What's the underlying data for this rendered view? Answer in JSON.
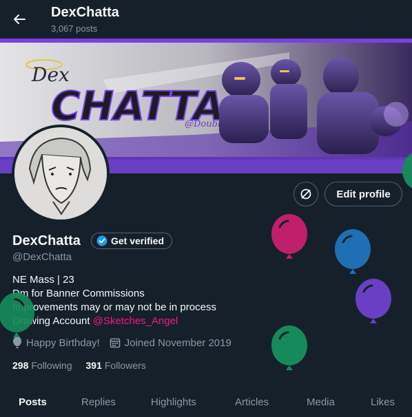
{
  "header": {
    "title": "DexChatta",
    "posts_count": "3,067 posts"
  },
  "banner": {
    "logo_script": "Dex",
    "logo_main": "CHATTA",
    "logo_tag": "@Doublers"
  },
  "profile": {
    "display_name": "DexChatta",
    "handle": "@DexChatta",
    "get_verified_label": "Get verified",
    "edit_profile_label": "Edit profile",
    "bio_lines": [
      "NE Mass | 23",
      "Dm for Banner Commissions",
      "Improvements may or may not be in process",
      "Drawing Account "
    ],
    "bio_mention": "@Sketches_Angel",
    "birthday": "Happy Birthday!",
    "joined": "Joined November 2019",
    "following_count": "298",
    "following_label": "Following",
    "followers_count": "391",
    "followers_label": "Followers"
  },
  "tabs": [
    {
      "label": "Posts",
      "active": true
    },
    {
      "label": "Replies",
      "active": false
    },
    {
      "label": "Highlights",
      "active": false
    },
    {
      "label": "Articles",
      "active": false
    },
    {
      "label": "Media",
      "active": false
    },
    {
      "label": "Likes",
      "active": false
    }
  ],
  "colors": {
    "background": "#15202b",
    "accent_verified": "#1d9bf0",
    "mention": "#f91880",
    "banner_purple": "#7b3fe4",
    "balloon_magenta": "#c0206b",
    "balloon_blue": "#1f6fb5",
    "balloon_purple": "#6a3fc4",
    "balloon_green": "#168a5a"
  },
  "icons": [
    "back-arrow-icon",
    "refresh-circle-icon",
    "verified-badge-icon",
    "balloon-icon",
    "calendar-icon"
  ]
}
